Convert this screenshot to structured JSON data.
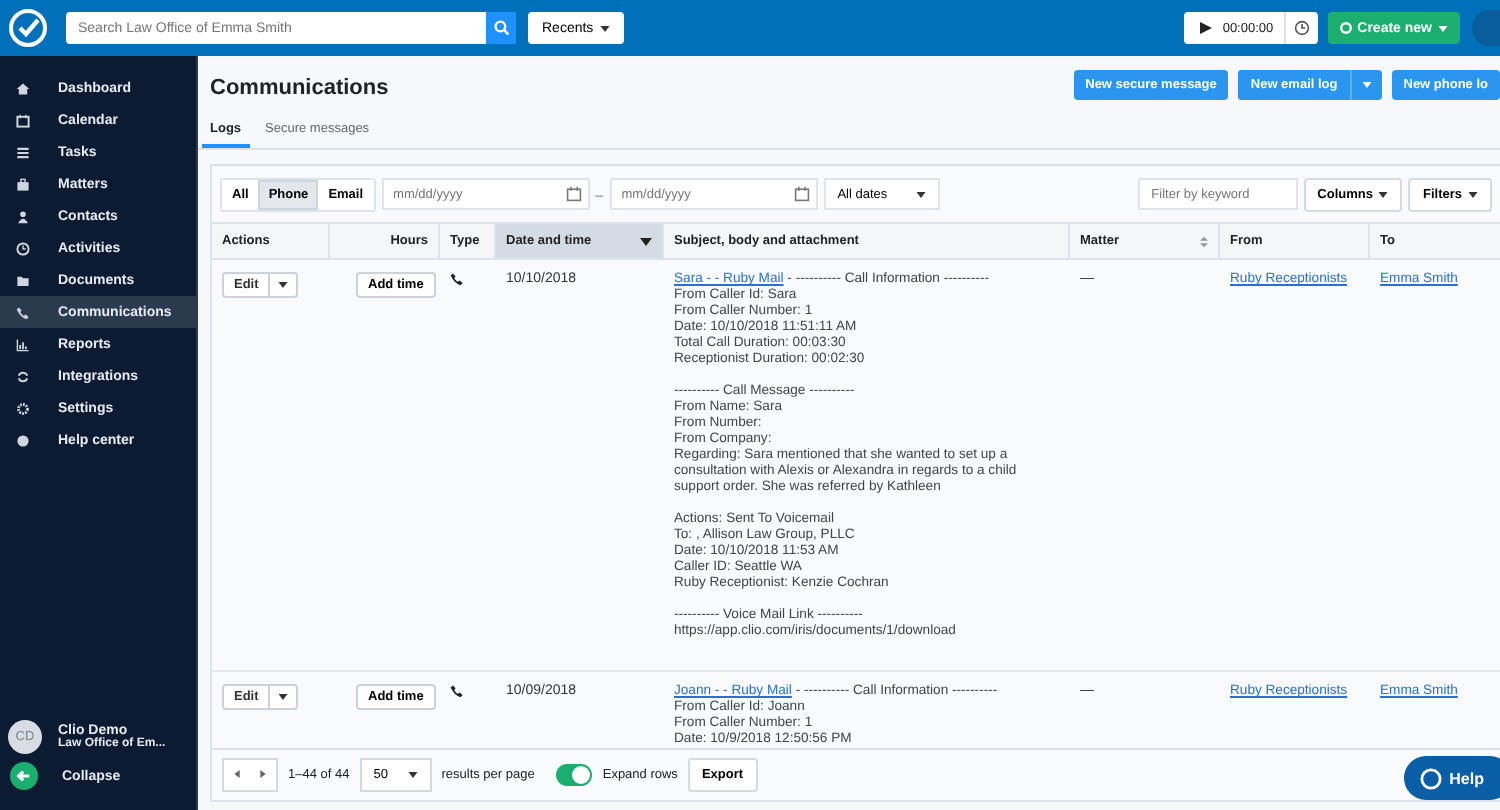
{
  "topbar": {
    "search": {
      "placeholder": "Search Law Office of Emma Smith"
    },
    "recents": "Recents",
    "timer": "00:00:00",
    "create": "Create new"
  },
  "sidebar": {
    "items": [
      {
        "label": "Dashboard",
        "selected": false
      },
      {
        "label": "Calendar",
        "selected": false
      },
      {
        "label": "Tasks",
        "selected": false
      },
      {
        "label": "Matters",
        "selected": false
      },
      {
        "label": "Contacts",
        "selected": false
      },
      {
        "label": "Activities",
        "selected": false
      },
      {
        "label": "Documents",
        "selected": false
      },
      {
        "label": "Communications",
        "selected": true
      },
      {
        "label": "Reports",
        "selected": false
      },
      {
        "label": "Integrations",
        "selected": false
      },
      {
        "label": "Settings",
        "selected": false
      },
      {
        "label": "Help center",
        "selected": false
      }
    ],
    "user": {
      "initials": "CD",
      "name": "Clio Demo",
      "firm": "Law Office of Em..."
    },
    "collapse": "Collapse"
  },
  "page": {
    "title": "Communications",
    "actions": [
      "New secure message",
      "New email log",
      "New phone lo"
    ]
  },
  "tabs": [
    {
      "label": "Logs",
      "selected": true
    },
    {
      "label": "Secure messages",
      "selected": false
    }
  ],
  "toolbar": {
    "types": [
      {
        "label": "All",
        "selected": false
      },
      {
        "label": "Phone",
        "selected": true
      },
      {
        "label": "Email",
        "selected": false
      }
    ],
    "date_from": {
      "placeholder": "mm/dd/yyyy"
    },
    "date_to": {
      "placeholder": "mm/dd/yyyy"
    },
    "separator": "–",
    "range": "All dates",
    "keyword": {
      "placeholder": "Filter by keyword"
    },
    "columns": "Columns",
    "filters": "Filters"
  },
  "table": {
    "columns": [
      {
        "label": "Actions",
        "kind": "plain"
      },
      {
        "label": "Hours",
        "kind": "plain"
      },
      {
        "label": "Type",
        "kind": "plain"
      },
      {
        "label": "Date and time",
        "kind": "sorted"
      },
      {
        "label": "Subject, body and attachment",
        "kind": "plain"
      },
      {
        "label": "Matter",
        "kind": "sortable"
      },
      {
        "label": "From",
        "kind": "plain"
      },
      {
        "label": "To",
        "kind": "plain"
      }
    ],
    "rows": [
      {
        "edit": "Edit",
        "add_time": "Add time",
        "date": "10/10/2018",
        "subject_link": "Sara - - Ruby Mail",
        "subject_rest": "- ---------- Call Information ----------",
        "body": [
          [
            "From Caller Id: Sara",
            "From Caller Number: 1",
            "Date: 10/10/2018 11:51:11 AM",
            "Total Call Duration: 00:03:30",
            "Receptionist Duration: 00:02:30"
          ],
          [
            "---------- Call Message ----------",
            "From Name: Sara",
            "From Number:",
            "From Company:",
            "Regarding: Sara mentioned that she wanted to set up a consultation with Alexis or Alexandra in regards to a child support order. She was referred by Kathleen"
          ],
          [
            "Actions: Sent To Voicemail",
            "To: , Allison Law Group, PLLC",
            "Date: 10/10/2018 11:53 AM",
            "Caller ID: Seattle WA",
            "Ruby Receptionist: Kenzie Cochran"
          ],
          [
            "---------- Voice Mail Link ----------",
            "https://app.clio.com/iris/documents/1/download"
          ]
        ],
        "matter": "—",
        "from": "Ruby Receptionists",
        "to": "Emma Smith"
      },
      {
        "edit": "Edit",
        "add_time": "Add time",
        "date": "10/09/2018",
        "subject_link": "Joann - - Ruby Mail",
        "subject_rest": "- ---------- Call Information ----------",
        "body": [
          [
            "From Caller Id: Joann",
            "From Caller Number: 1",
            "Date: 10/9/2018 12:50:56 PM"
          ]
        ],
        "matter": "—",
        "from": "Ruby Receptionists",
        "to": "Emma Smith"
      }
    ]
  },
  "footer": {
    "range": "1–44 of 44",
    "per_page": "50",
    "per_page_label": "results per page",
    "expand": {
      "label": "Expand rows",
      "on": true
    },
    "export": "Export"
  },
  "help": "Help"
}
